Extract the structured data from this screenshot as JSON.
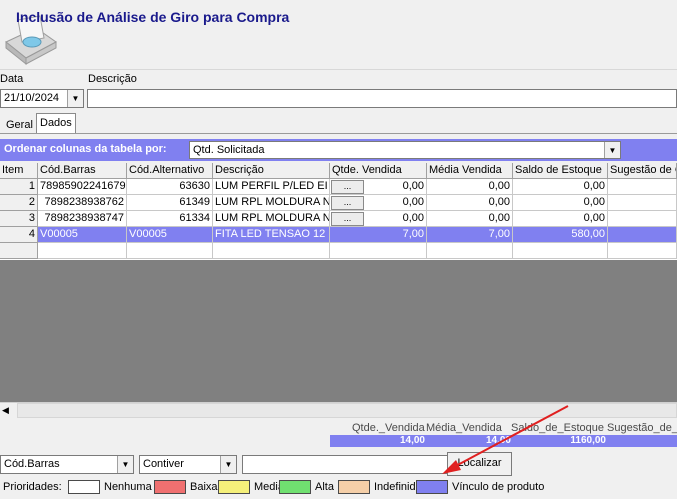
{
  "window": {
    "title": "Inclusão de Análise de Giro para Compra"
  },
  "form": {
    "date_label": "Data",
    "date_value": "21/10/2024",
    "desc_label": "Descrição",
    "desc_value": ""
  },
  "tabs": [
    {
      "label": "Geral",
      "active": false
    },
    {
      "label": "Dados",
      "active": true
    }
  ],
  "order": {
    "label": "Ordenar colunas da tabela por:",
    "selected": "Qtd. Solicitada"
  },
  "table": {
    "columns": [
      "Item",
      "Cód.Barras",
      "Cód.Alternativo",
      "Descrição",
      "Qtde. Vendida",
      "Média Vendida",
      "Saldo de Estoque",
      "Sugestão de C"
    ],
    "rows": [
      {
        "item": "1",
        "barras": "78985902241679",
        "alt": "63630",
        "desc": "LUM PERFIL P/LED EI",
        "btn": "...",
        "qtde": "0,00",
        "media": "0,00",
        "saldo": "0,00",
        "selected": false
      },
      {
        "item": "2",
        "barras": "7898238938762",
        "alt": "61349",
        "desc": "LUM RPL MOLDURA N",
        "btn": "...",
        "qtde": "0,00",
        "media": "0,00",
        "saldo": "0,00",
        "selected": false
      },
      {
        "item": "3",
        "barras": "7898238938747",
        "alt": "61334",
        "desc": "LUM RPL MOLDURA N",
        "btn": "...",
        "qtde": "0,00",
        "media": "0,00",
        "saldo": "0,00",
        "selected": false
      },
      {
        "item": "4",
        "barras": "V00005",
        "alt": "V00005",
        "desc": "FITA LED TENSAO 12",
        "btn": "",
        "qtde": "7,00",
        "media": "7,00",
        "saldo": "580,00",
        "selected": true
      }
    ]
  },
  "totals": {
    "labels": [
      "Qtde._Vendida",
      "Média_Vendida",
      "Saldo_de_Estoque",
      "Sugestão_de_C"
    ],
    "values": [
      "14,00",
      "14,00",
      "1160,00"
    ]
  },
  "search": {
    "field_selected": "Cód.Barras",
    "mode_selected": "Contiver",
    "value": "",
    "button_label": "Localizar"
  },
  "priorities": {
    "label": "Prioridades:",
    "items": [
      {
        "label": "Nenhuma",
        "color": "#ffffff"
      },
      {
        "label": "Baixa",
        "color": "#f07070"
      },
      {
        "label": "Media",
        "color": "#f5f07a"
      },
      {
        "label": "Alta",
        "color": "#70e070"
      },
      {
        "label": "Indefinida",
        "color": "#f5cfa8"
      },
      {
        "label": "Vínculo de produto",
        "color": "#8080f0"
      }
    ]
  }
}
